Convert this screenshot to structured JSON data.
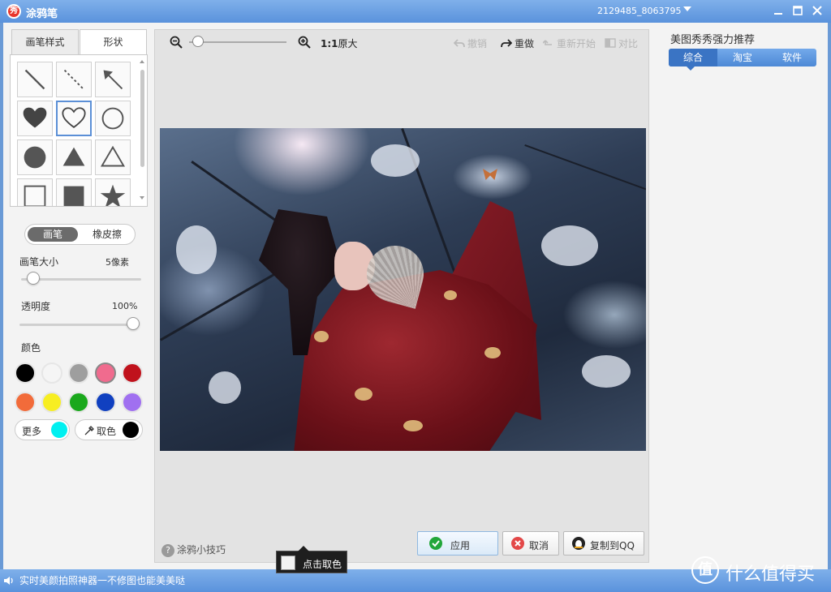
{
  "window": {
    "logo_text": "秀",
    "title": "涂鸦笔",
    "user_id": "2129485_8063795"
  },
  "left_panel": {
    "tabs": [
      "画笔样式",
      "形状"
    ],
    "shapes": [
      "line-icon",
      "dashed-line-icon",
      "arrow-icon",
      "heart-filled-icon",
      "heart-outline-icon",
      "circle-outline-icon",
      "circle-filled-icon",
      "triangle-filled-icon",
      "triangle-outline-icon",
      "square-outline-icon",
      "square-filled-icon",
      "star-filled-icon"
    ],
    "selected_shape": "heart-outline-icon",
    "mode_toggle": {
      "brush": "画笔",
      "eraser": "橡皮擦"
    },
    "brush_size": {
      "label": "画笔大小",
      "value": "5像素",
      "level": 0.05
    },
    "opacity": {
      "label": "透明度",
      "value": "100%",
      "level": 1.0
    },
    "colors_label": "颜色",
    "colors": [
      "#000000",
      "#f5f5f5",
      "#9e9e9e",
      "#f06b8e",
      "#c0121c",
      "#f26b3a",
      "#f7ee22",
      "#1aa81c",
      "#1040c0",
      "#a070f0"
    ],
    "selected_color": "#f06b8e",
    "more_label": "更多",
    "more_color": "#00f0f0",
    "picker_label": "取色",
    "picker_color": "#000000"
  },
  "toolbar": {
    "ratio": "1:1",
    "ratio_label": "原大",
    "undo": "撤销",
    "redo": "重做",
    "restart": "重新开始",
    "compare": "对比",
    "zoom_level": 0.1
  },
  "bottom": {
    "tips": "涂鸦小技巧",
    "apply": "应用",
    "cancel": "取消",
    "copy_qq": "复制到QQ"
  },
  "tooltip": {
    "text": "点击取色"
  },
  "right_panel": {
    "title": "美图秀秀强力推荐",
    "tabs": [
      "综合",
      "淘宝",
      "软件"
    ],
    "active_tab": "综合"
  },
  "status": {
    "text": "实时美颜拍照神器一不修图也能美美哒"
  },
  "watermark": {
    "logo": "值",
    "text": "什么值得买"
  },
  "colors": {
    "titlebar": "#6a9ad6",
    "accent": "#3a74c4"
  }
}
